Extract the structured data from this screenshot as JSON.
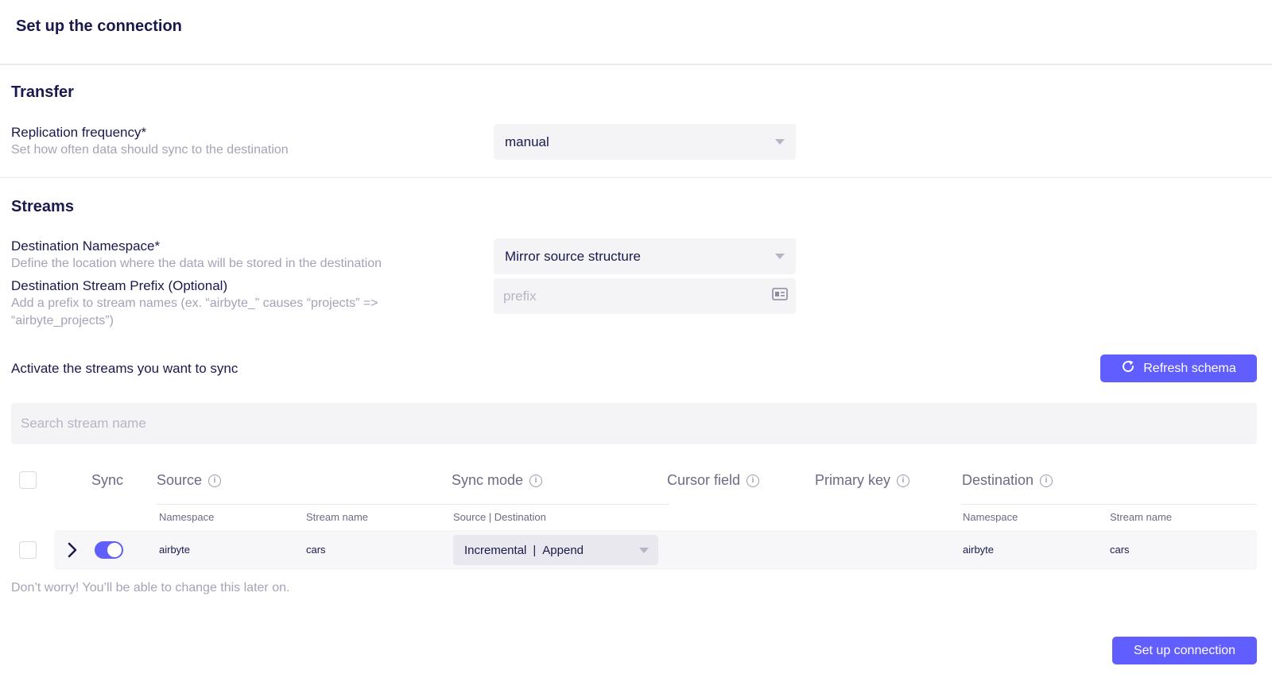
{
  "page": {
    "title": "Set up the connection"
  },
  "transfer": {
    "title": "Transfer",
    "frequency_label": "Replication frequency*",
    "frequency_desc": "Set how often data should sync to the destination",
    "frequency_value": "manual"
  },
  "streams": {
    "title": "Streams",
    "namespace_label": "Destination Namespace*",
    "namespace_desc": "Define the location where the data will be stored in the destination",
    "namespace_value": "Mirror source structure",
    "prefix_label": "Destination Stream Prefix (Optional)",
    "prefix_desc_line1": "Add a prefix to stream names (ex. “airbyte_” causes “projects” =>",
    "prefix_desc_line2": "“airbyte_projects”)",
    "prefix_placeholder": "prefix",
    "activate_label": "Activate the streams you want to sync",
    "refresh_label": "Refresh schema",
    "search_placeholder": "Search stream name"
  },
  "table": {
    "headers": {
      "sync": "Sync",
      "source": "Source",
      "sync_mode": "Sync mode",
      "cursor_field": "Cursor field",
      "primary_key": "Primary key",
      "destination": "Destination"
    },
    "subheaders": {
      "source_namespace": "Namespace",
      "source_stream_name": "Stream name",
      "sync_mode": "Source | Destination",
      "dest_namespace": "Namespace",
      "dest_stream_name": "Stream name"
    },
    "rows": [
      {
        "sync_enabled": true,
        "source_namespace": "airbyte",
        "source_stream_name": "cars",
        "sync_mode_source": "Incremental",
        "sync_mode_destination": "Append",
        "dest_namespace": "airbyte",
        "dest_stream_name": "cars"
      }
    ]
  },
  "footer": {
    "note": "Don’t worry! You’ll be able to change this later on.",
    "submit_label": "Set up connection"
  },
  "colors": {
    "accent": "#615eff",
    "text": "#1a194d",
    "muted": "#a3a3b8"
  },
  "icons": [
    "chevron-down-icon",
    "id-card-icon",
    "refresh-icon",
    "info-icon",
    "chevron-right-icon"
  ]
}
